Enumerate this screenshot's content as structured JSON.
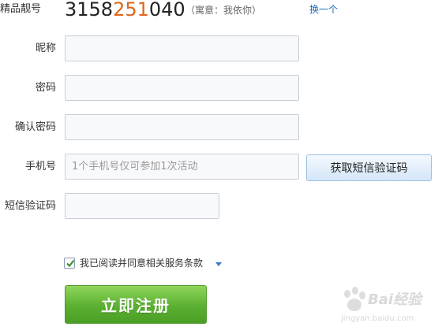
{
  "number_section": {
    "label": "精品靓号",
    "number_prefix": "3158",
    "number_highlight": "251",
    "number_suffix": "040",
    "meaning": "（寓意：我依你）",
    "swap_link": "换一个"
  },
  "form": {
    "nickname_label": "昵称",
    "nickname_value": "",
    "password_label": "密码",
    "password_value": "",
    "confirm_label": "确认密码",
    "confirm_value": "",
    "phone_label": "手机号",
    "phone_placeholder": "1个手机号仅可参加1次活动",
    "sms_button": "获取短信验证码",
    "sms_code_label": "短信验证码",
    "sms_code_value": ""
  },
  "agreement": {
    "checked": true,
    "text": "我已阅读并同意相关服务条款"
  },
  "register_button": "立即注册",
  "watermark": {
    "brand": "Bai经验",
    "url": "jingyan.baidu.com"
  },
  "colors": {
    "highlight": "#e0651c",
    "link": "#1f66b8",
    "register_green": "#5bb031"
  }
}
